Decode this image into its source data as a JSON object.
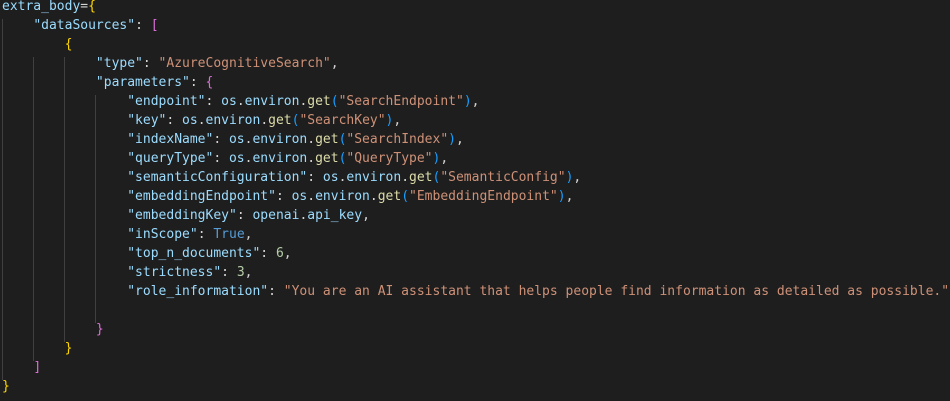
{
  "editor": {
    "lines": [
      [
        {
          "t": "extra_body",
          "c": "k"
        },
        {
          "t": "=",
          "c": "p"
        },
        {
          "t": "{",
          "c": "br1"
        }
      ],
      [
        {
          "t": "    ",
          "c": "p"
        },
        {
          "t": "\"dataSources\"",
          "c": "k"
        },
        {
          "t": ": ",
          "c": "p"
        },
        {
          "t": "[",
          "c": "br2"
        }
      ],
      [
        {
          "t": "        ",
          "c": "p"
        },
        {
          "t": "{",
          "c": "br1"
        }
      ],
      [
        {
          "t": "            ",
          "c": "p"
        },
        {
          "t": "\"type\"",
          "c": "k"
        },
        {
          "t": ": ",
          "c": "p"
        },
        {
          "t": "\"AzureCognitiveSearch\"",
          "c": "s"
        },
        {
          "t": ",",
          "c": "p"
        }
      ],
      [
        {
          "t": "            ",
          "c": "p"
        },
        {
          "t": "\"parameters\"",
          "c": "k"
        },
        {
          "t": ": ",
          "c": "p"
        },
        {
          "t": "{",
          "c": "br2"
        }
      ],
      [
        {
          "t": "                ",
          "c": "p"
        },
        {
          "t": "\"endpoint\"",
          "c": "k"
        },
        {
          "t": ": ",
          "c": "p"
        },
        {
          "t": "os",
          "c": "k"
        },
        {
          "t": ".",
          "c": "p"
        },
        {
          "t": "environ",
          "c": "k"
        },
        {
          "t": ".",
          "c": "p"
        },
        {
          "t": "get",
          "c": "f"
        },
        {
          "t": "(",
          "c": "br3"
        },
        {
          "t": "\"SearchEndpoint\"",
          "c": "s"
        },
        {
          "t": ")",
          "c": "br3"
        },
        {
          "t": ",",
          "c": "p"
        }
      ],
      [
        {
          "t": "                ",
          "c": "p"
        },
        {
          "t": "\"key\"",
          "c": "k"
        },
        {
          "t": ": ",
          "c": "p"
        },
        {
          "t": "os",
          "c": "k"
        },
        {
          "t": ".",
          "c": "p"
        },
        {
          "t": "environ",
          "c": "k"
        },
        {
          "t": ".",
          "c": "p"
        },
        {
          "t": "get",
          "c": "f"
        },
        {
          "t": "(",
          "c": "br3"
        },
        {
          "t": "\"SearchKey\"",
          "c": "s"
        },
        {
          "t": ")",
          "c": "br3"
        },
        {
          "t": ",",
          "c": "p"
        }
      ],
      [
        {
          "t": "                ",
          "c": "p"
        },
        {
          "t": "\"indexName\"",
          "c": "k"
        },
        {
          "t": ": ",
          "c": "p"
        },
        {
          "t": "os",
          "c": "k"
        },
        {
          "t": ".",
          "c": "p"
        },
        {
          "t": "environ",
          "c": "k"
        },
        {
          "t": ".",
          "c": "p"
        },
        {
          "t": "get",
          "c": "f"
        },
        {
          "t": "(",
          "c": "br3"
        },
        {
          "t": "\"SearchIndex\"",
          "c": "s"
        },
        {
          "t": ")",
          "c": "br3"
        },
        {
          "t": ",",
          "c": "p"
        }
      ],
      [
        {
          "t": "                ",
          "c": "p"
        },
        {
          "t": "\"queryType\"",
          "c": "k"
        },
        {
          "t": ": ",
          "c": "p"
        },
        {
          "t": "os",
          "c": "k"
        },
        {
          "t": ".",
          "c": "p"
        },
        {
          "t": "environ",
          "c": "k"
        },
        {
          "t": ".",
          "c": "p"
        },
        {
          "t": "get",
          "c": "f"
        },
        {
          "t": "(",
          "c": "br3"
        },
        {
          "t": "\"QueryType\"",
          "c": "s"
        },
        {
          "t": ")",
          "c": "br3"
        },
        {
          "t": ",",
          "c": "p"
        }
      ],
      [
        {
          "t": "                ",
          "c": "p"
        },
        {
          "t": "\"semanticConfiguration\"",
          "c": "k"
        },
        {
          "t": ": ",
          "c": "p"
        },
        {
          "t": "os",
          "c": "k"
        },
        {
          "t": ".",
          "c": "p"
        },
        {
          "t": "environ",
          "c": "k"
        },
        {
          "t": ".",
          "c": "p"
        },
        {
          "t": "get",
          "c": "f"
        },
        {
          "t": "(",
          "c": "br3"
        },
        {
          "t": "\"SemanticConfig\"",
          "c": "s"
        },
        {
          "t": ")",
          "c": "br3"
        },
        {
          "t": ",",
          "c": "p"
        }
      ],
      [
        {
          "t": "                ",
          "c": "p"
        },
        {
          "t": "\"embeddingEndpoint\"",
          "c": "k"
        },
        {
          "t": ": ",
          "c": "p"
        },
        {
          "t": "os",
          "c": "k"
        },
        {
          "t": ".",
          "c": "p"
        },
        {
          "t": "environ",
          "c": "k"
        },
        {
          "t": ".",
          "c": "p"
        },
        {
          "t": "get",
          "c": "f"
        },
        {
          "t": "(",
          "c": "br3"
        },
        {
          "t": "\"EmbeddingEndpoint\"",
          "c": "s"
        },
        {
          "t": ")",
          "c": "br3"
        },
        {
          "t": ",",
          "c": "p"
        }
      ],
      [
        {
          "t": "                ",
          "c": "p"
        },
        {
          "t": "\"embeddingKey\"",
          "c": "k"
        },
        {
          "t": ": ",
          "c": "p"
        },
        {
          "t": "openai",
          "c": "k"
        },
        {
          "t": ".",
          "c": "p"
        },
        {
          "t": "api_key",
          "c": "k"
        },
        {
          "t": ",",
          "c": "p"
        }
      ],
      [
        {
          "t": "                ",
          "c": "p"
        },
        {
          "t": "\"inScope\"",
          "c": "k"
        },
        {
          "t": ": ",
          "c": "p"
        },
        {
          "t": "True",
          "c": "b"
        },
        {
          "t": ",",
          "c": "p"
        }
      ],
      [
        {
          "t": "                ",
          "c": "p"
        },
        {
          "t": "\"top_n_documents\"",
          "c": "k"
        },
        {
          "t": ": ",
          "c": "p"
        },
        {
          "t": "6",
          "c": "n"
        },
        {
          "t": ",",
          "c": "p"
        }
      ],
      [
        {
          "t": "                ",
          "c": "p"
        },
        {
          "t": "\"strictness\"",
          "c": "k"
        },
        {
          "t": ": ",
          "c": "p"
        },
        {
          "t": "3",
          "c": "n"
        },
        {
          "t": ",",
          "c": "p"
        }
      ],
      [
        {
          "t": "                ",
          "c": "p"
        },
        {
          "t": "\"role_information\"",
          "c": "k"
        },
        {
          "t": ": ",
          "c": "p"
        },
        {
          "t": "\"You are an AI assistant that helps people find information as detailed as possible.\"",
          "c": "s"
        },
        {
          "t": ",",
          "c": "p"
        }
      ],
      [
        {
          "t": "",
          "c": "p"
        }
      ],
      [
        {
          "t": "            ",
          "c": "p"
        },
        {
          "t": "}",
          "c": "br2"
        }
      ],
      [
        {
          "t": "        ",
          "c": "p"
        },
        {
          "t": "}",
          "c": "br1"
        }
      ],
      [
        {
          "t": "    ",
          "c": "p"
        },
        {
          "t": "]",
          "c": "br2"
        }
      ],
      [
        {
          "t": "}",
          "c": "br1"
        }
      ]
    ]
  },
  "colors": {
    "background": "#1e1e1e",
    "property": "#9cdcfe",
    "string": "#ce9178",
    "function": "#dcdcaa",
    "number": "#b5cea8",
    "keyword": "#569cd6",
    "bracket_gold": "#ffd700",
    "bracket_purple": "#da70d6",
    "bracket_blue": "#179fff",
    "indent_guide": "#404040"
  }
}
